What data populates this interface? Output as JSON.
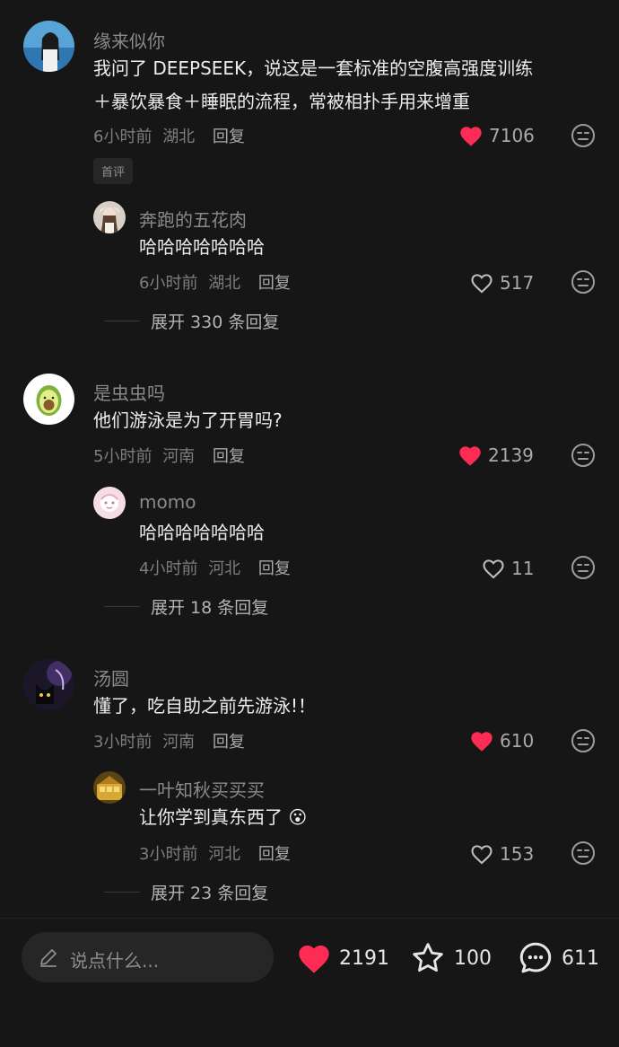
{
  "threads": [
    {
      "comment": {
        "username": "缘来似你",
        "text_lines": [
          "我问了 DEEPSEEK，说这是一套标准的空腹高强度训练",
          "＋暴饮暴食＋睡眠的流程，常被相扑手用来增重"
        ],
        "time": "6小时前",
        "location": "湖北",
        "reply_label": "回复",
        "likes": "7106",
        "liked": true,
        "tag": "首评"
      },
      "reply": {
        "username": "奔跑的五花肉",
        "text": "哈哈哈哈哈哈哈",
        "time": "6小时前",
        "location": "湖北",
        "reply_label": "回复",
        "likes": "517",
        "liked": false
      },
      "expand_label": "展开 330 条回复"
    },
    {
      "comment": {
        "username": "是虫虫吗",
        "text_lines": [
          "他们游泳是为了开胃吗?"
        ],
        "time": "5小时前",
        "location": "河南",
        "reply_label": "回复",
        "likes": "2139",
        "liked": true
      },
      "reply": {
        "username": "momo",
        "text": "哈哈哈哈哈哈哈",
        "time": "4小时前",
        "location": "河北",
        "reply_label": "回复",
        "likes": "11",
        "liked": false
      },
      "expand_label": "展开 18 条回复"
    },
    {
      "comment": {
        "username": "汤圆",
        "text_lines": [
          "懂了，吃自助之前先游泳!！"
        ],
        "time": "3小时前",
        "location": "河南",
        "reply_label": "回复",
        "likes": "610",
        "liked": true
      },
      "reply": {
        "username": "一叶知秋买买买",
        "text": "让你学到真东西了",
        "emoji": "😮",
        "time": "3小时前",
        "location": "河北",
        "reply_label": "回复",
        "likes": "153",
        "liked": false
      },
      "expand_label": "展开 23 条回复"
    }
  ],
  "bottom_bar": {
    "input_placeholder": "说点什么...",
    "likes": "2191",
    "favorites": "100",
    "comments": "611"
  },
  "colors": {
    "background": "#161616",
    "liked_heart": "#fe2c55",
    "text_primary": "#ececec",
    "text_secondary": "#8a8a8a"
  }
}
